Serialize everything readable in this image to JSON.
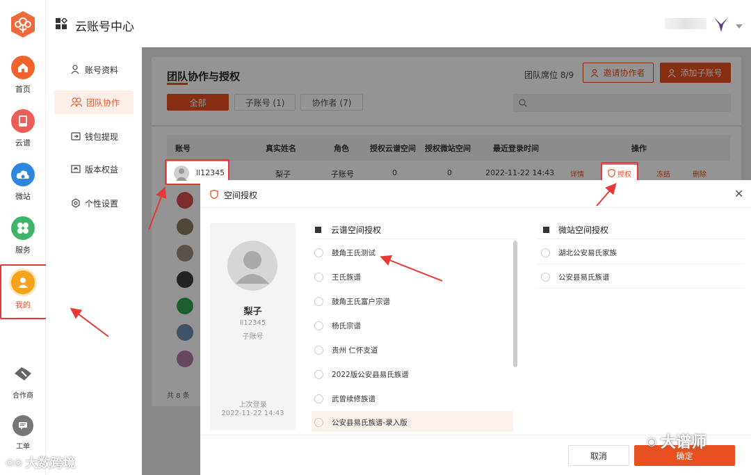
{
  "app": {
    "title": "云账号中心"
  },
  "rail": {
    "items": [
      {
        "label": "首页"
      },
      {
        "label": "云谱"
      },
      {
        "label": "微站"
      },
      {
        "label": "服务"
      },
      {
        "label": "我的"
      },
      {
        "label": "合作商"
      },
      {
        "label": "工单"
      }
    ]
  },
  "menu": {
    "items": [
      {
        "label": "账号资料"
      },
      {
        "label": "团队协作"
      },
      {
        "label": "钱包提现"
      },
      {
        "label": "版本权益"
      },
      {
        "label": "个性设置"
      }
    ]
  },
  "page": {
    "title": "团队协作与授权",
    "seats": "团队席位 8/9",
    "invite_label": "邀请协作者",
    "add_label": "添加子账号",
    "tabs": [
      "全部",
      "子账号 (1)",
      "协作者 (7)"
    ],
    "total": "共 8 条"
  },
  "table": {
    "headers": [
      "账号",
      "真实姓名",
      "角色",
      "授权云谱空间",
      "授权微站空间",
      "最近登录时间",
      "操作"
    ],
    "row": {
      "account": "ll12345",
      "name": "梨子",
      "role": "子账号",
      "pu": "0",
      "wz": "0",
      "last_login": "2022-11-22 14:43",
      "actions": [
        "详情",
        "授权",
        "冻结",
        "删除"
      ]
    }
  },
  "modal": {
    "title": "空间授权",
    "user_name": "梨子",
    "user_account": "ll12345",
    "user_role": "子账号",
    "last_login_label": "上次登录",
    "last_login": "2022-11-22 14:43",
    "pu_section": "云谱空间授权",
    "wz_section": "微站空间授权",
    "pu_items": [
      "鼓角王氏测试",
      "王氏族谱",
      "鼓角王氏富户宗谱",
      "杨氏宗谱",
      "贵州 仁怀支道",
      "2022版公安县易氏族谱",
      "武曾续修族谱",
      "公安县易氏族谱-录入版"
    ],
    "wz_items": [
      "湖北公安易氏家族",
      "公安县易氏族谱"
    ],
    "cancel": "取消",
    "confirm": "确定"
  },
  "watermarks": {
    "left": "大数跨境",
    "right": "大谱师"
  },
  "colors": {
    "accent": "#e8501f",
    "highlight": "#e53935"
  }
}
